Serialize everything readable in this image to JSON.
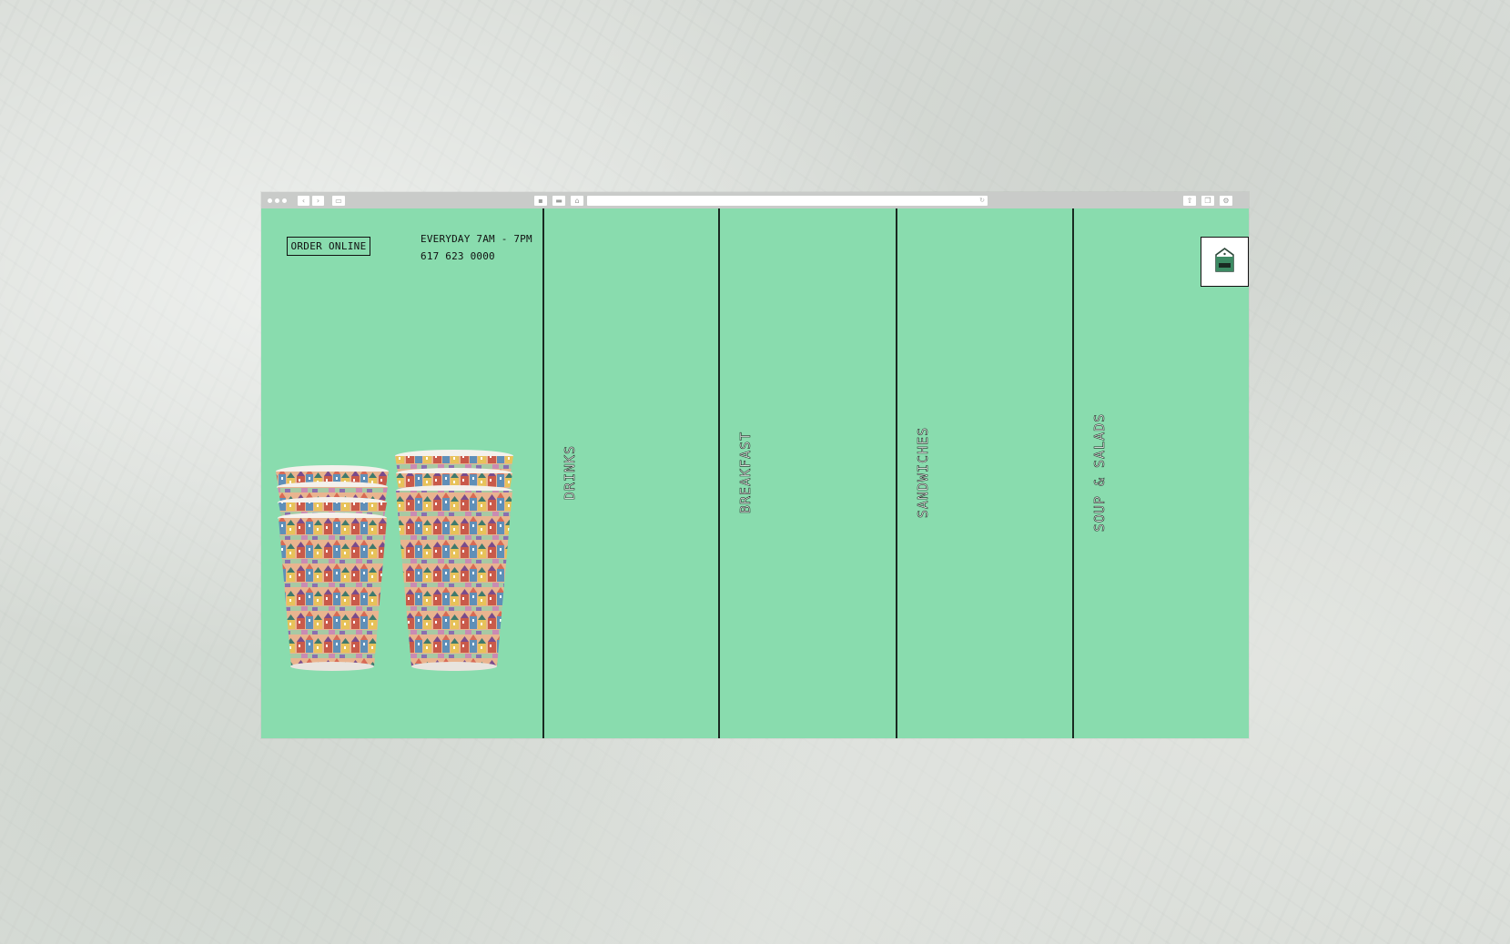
{
  "page": {
    "order_online": "ORDER ONLINE",
    "hours": "EVERYDAY 7AM - 7PM",
    "phone": "617 623 0000"
  },
  "menu": [
    {
      "label": "DRINKS"
    },
    {
      "label": "BREAKFAST"
    },
    {
      "label": "SANDWICHES"
    },
    {
      "label": "SOUP & SALADS"
    }
  ],
  "icons": {
    "logo": "house-logo-icon",
    "back": "chevron-left-icon",
    "forward": "chevron-right-icon",
    "sidebar": "sidebar-icon",
    "reload": "reload-icon"
  },
  "colors": {
    "page_background": "#89dcae",
    "divider": "#1a2a22",
    "chrome": "#c9cbc9"
  }
}
